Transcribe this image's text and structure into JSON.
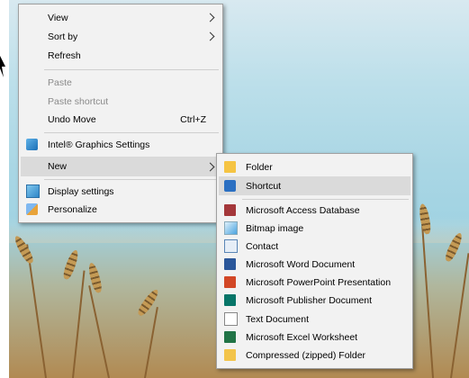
{
  "context_menu": {
    "items": [
      {
        "label": "View",
        "submenu": true
      },
      {
        "label": "Sort by",
        "submenu": true
      },
      {
        "label": "Refresh"
      },
      {
        "label": "Paste",
        "disabled": true
      },
      {
        "label": "Paste shortcut",
        "disabled": true
      },
      {
        "label": "Undo Move",
        "shortcut": "Ctrl+Z"
      },
      {
        "label": "Intel® Graphics Settings",
        "icon": "intel-graphics-icon"
      },
      {
        "label": "New",
        "submenu": true,
        "highlighted": true
      },
      {
        "label": "Display settings",
        "icon": "display-icon"
      },
      {
        "label": "Personalize",
        "icon": "personalize-icon"
      }
    ]
  },
  "new_submenu": {
    "items": [
      {
        "label": "Folder",
        "icon": "folder-icon"
      },
      {
        "label": "Shortcut",
        "icon": "shortcut-icon",
        "highlighted": true
      },
      {
        "label": "Microsoft Access Database",
        "icon": "access-icon"
      },
      {
        "label": "Bitmap image",
        "icon": "bitmap-icon"
      },
      {
        "label": "Contact",
        "icon": "contact-icon"
      },
      {
        "label": "Microsoft Word Document",
        "icon": "word-icon"
      },
      {
        "label": "Microsoft PowerPoint Presentation",
        "icon": "powerpoint-icon"
      },
      {
        "label": "Microsoft Publisher Document",
        "icon": "publisher-icon"
      },
      {
        "label": "Text Document",
        "icon": "text-document-icon"
      },
      {
        "label": "Microsoft Excel Worksheet",
        "icon": "excel-icon"
      },
      {
        "label": "Compressed (zipped) Folder",
        "icon": "zip-folder-icon"
      }
    ]
  }
}
